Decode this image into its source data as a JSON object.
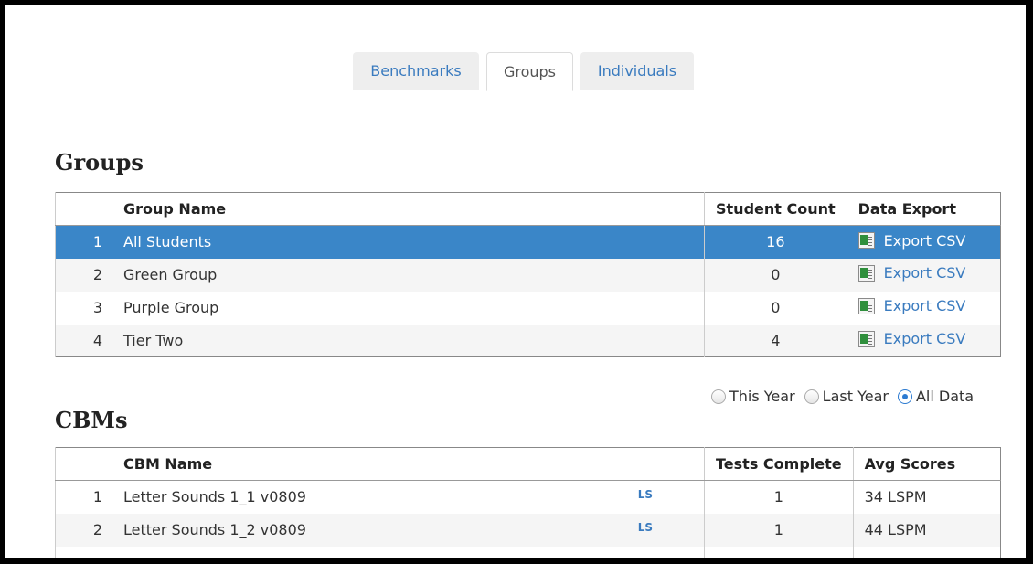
{
  "tabs": [
    {
      "label": "Benchmarks",
      "active": false
    },
    {
      "label": "Groups",
      "active": true
    },
    {
      "label": "Individuals",
      "active": false
    }
  ],
  "groups_section": {
    "title": "Groups",
    "headers": {
      "index": "",
      "name": "Group Name",
      "count": "Student Count",
      "export": "Data Export"
    },
    "rows": [
      {
        "index": "1",
        "name": "All Students",
        "count": "16",
        "export": "Export CSV",
        "selected": true
      },
      {
        "index": "2",
        "name": "Green Group",
        "count": "0",
        "export": "Export CSV"
      },
      {
        "index": "3",
        "name": "Purple Group",
        "count": "0",
        "export": "Export CSV"
      },
      {
        "index": "4",
        "name": "Tier Two",
        "count": "4",
        "export": "Export CSV"
      }
    ]
  },
  "time_filter": {
    "options": [
      "This Year",
      "Last Year",
      "All Data"
    ],
    "selected": "All Data"
  },
  "cbms_section": {
    "title": "CBMs",
    "headers": {
      "index": "",
      "name": "CBM Name",
      "tests": "Tests Complete",
      "avg": "Avg Scores"
    },
    "rows": [
      {
        "index": "1",
        "name": "Letter Sounds 1_1 v0809",
        "tag": "LS",
        "tests": "1",
        "avg": "34 LSPM"
      },
      {
        "index": "2",
        "name": "Letter Sounds 1_2 v0809",
        "tag": "LS",
        "tests": "1",
        "avg": "44 LSPM"
      }
    ]
  },
  "colors": {
    "accent": "#3a86c8",
    "link": "#3a7bbf",
    "export_icon": "#2f8f3c"
  }
}
